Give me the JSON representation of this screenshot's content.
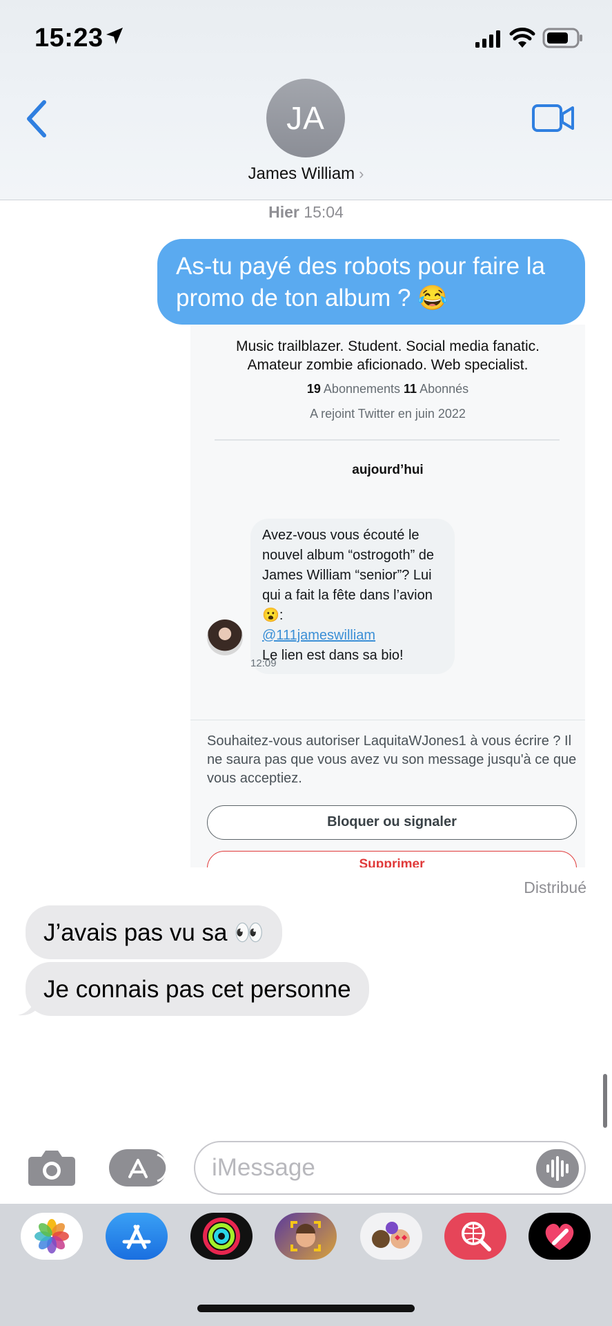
{
  "status_bar": {
    "time": "15:23"
  },
  "header": {
    "avatar_initials": "JA",
    "contact_name": "James William"
  },
  "conversation": {
    "timestamp_day": "Hier",
    "timestamp_time": "15:04",
    "sent_message": "As-tu payé des robots pour faire la promo de ton album ? 😂",
    "delivered_label": "Distribué",
    "received_messages": [
      "J’avais pas vu sa 👀",
      "Je connais pas cet personne"
    ]
  },
  "shared_screenshot": {
    "bio_line1": "Music trailblazer. Student. Social media fanatic.",
    "bio_line2": "Amateur zombie aficionado. Web specialist.",
    "following_count": "19",
    "following_label": "Abonnements",
    "followers_count": "11",
    "followers_label": "Abonnés",
    "joined": "A rejoint Twitter en juin 2022",
    "day_label": "aujourd’hui",
    "dm_text_1": "Avez-vous vous écouté le nouvel album “ostrogoth” de James William “senior”? Lui qui a fait la fête dans l’avion 😮:",
    "dm_mention": "@111jameswilliam",
    "dm_text_2": "Le lien est dans sa bio!",
    "dm_time": "12:09",
    "request_text": "Souhaitez-vous autoriser LaquitaWJones1 à vous écrire ? Il ne saura pas que vous avez vu son message jusqu'à ce que vous acceptiez.",
    "block_button": "Bloquer ou signaler",
    "delete_button": "Supprimer"
  },
  "input_bar": {
    "placeholder": "iMessage"
  },
  "app_drawer": {
    "apps": [
      "photos-icon",
      "app-store-icon",
      "activity-icon",
      "memoji-icon",
      "animoji-icon",
      "search-images-icon",
      "digital-touch-icon"
    ]
  },
  "colors": {
    "sent_bubble": "#5aaaf0",
    "received_bubble": "#e9e9eb",
    "ios_blue": "#2f7fe0",
    "link": "#3b8fd6",
    "danger": "#e03a3a"
  }
}
